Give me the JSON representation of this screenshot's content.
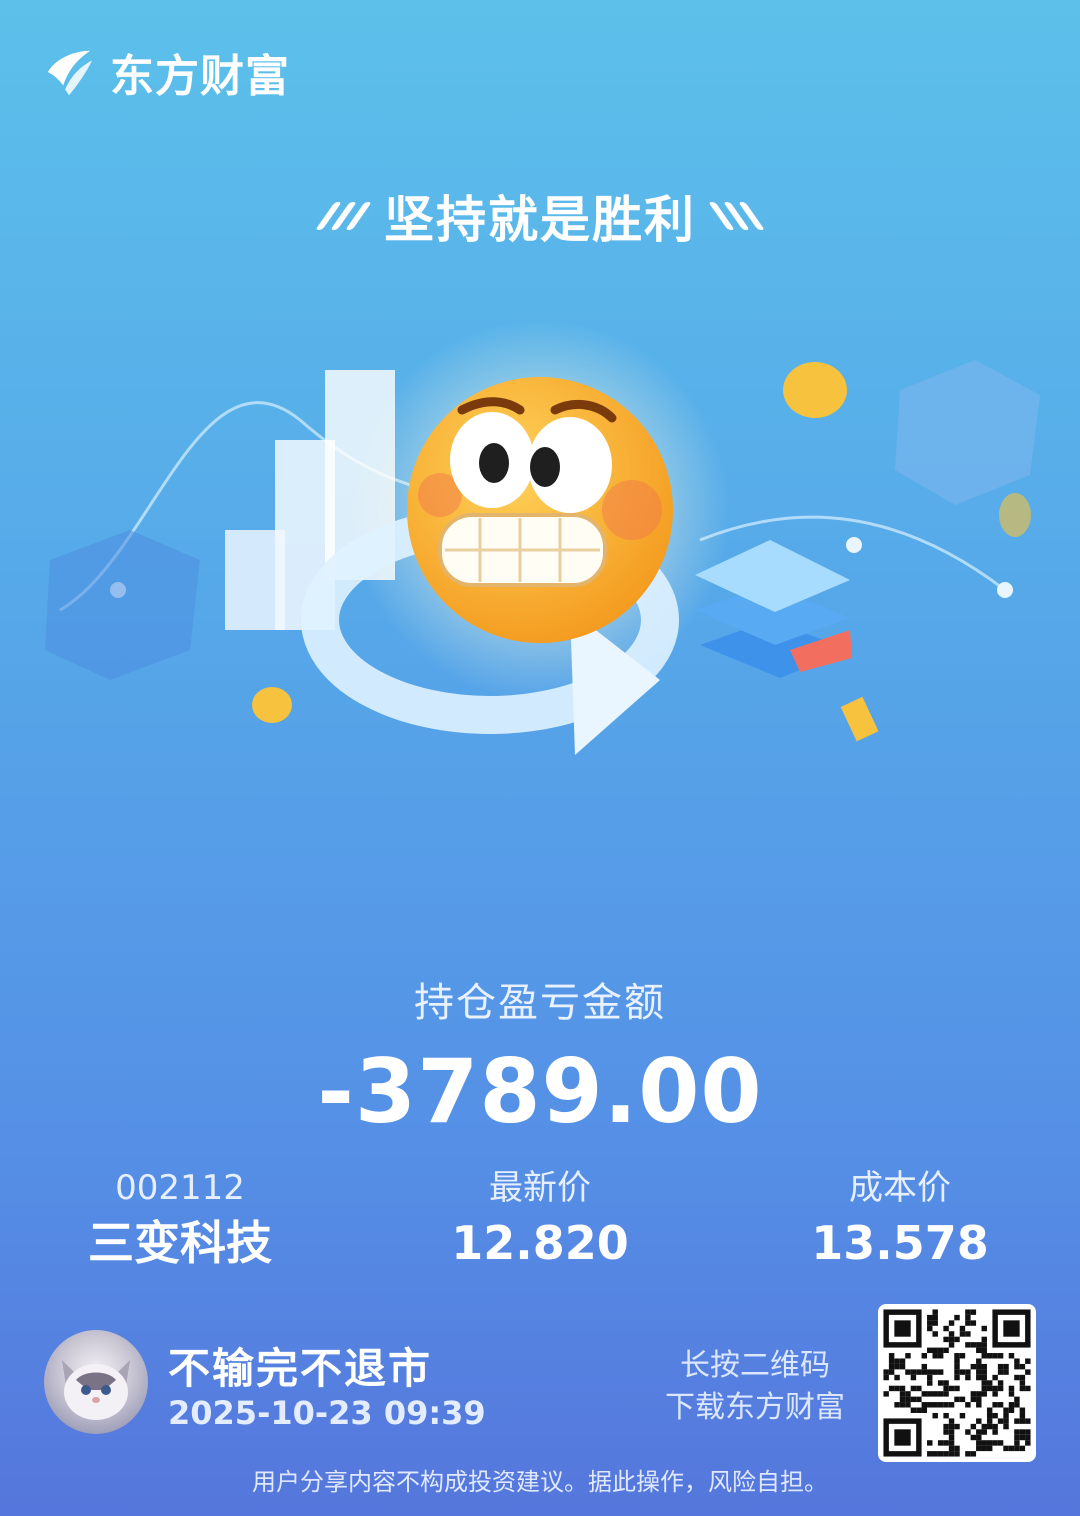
{
  "brand": {
    "name": "东方财富"
  },
  "slogan": "坚持就是胜利",
  "pnl": {
    "label": "持仓盈亏金额",
    "value": "-3789.00"
  },
  "stock": {
    "code": "002112",
    "name": "三变科技"
  },
  "latest_price": {
    "label": "最新价",
    "value": "12.820"
  },
  "cost_price": {
    "label": "成本价",
    "value": "13.578"
  },
  "user": {
    "name": "不输完不退市",
    "datetime": "2025-10-23 09:39"
  },
  "qr_hint": {
    "line1": "长按二维码",
    "line2": "下载东方财富"
  },
  "disclaimer": "用户分享内容不构成投资建议。据此操作，风险自担。",
  "colors": {
    "bg_top": "#5cc0ea",
    "bg_bottom": "#5576dc",
    "emoji": "#f7b23a"
  }
}
